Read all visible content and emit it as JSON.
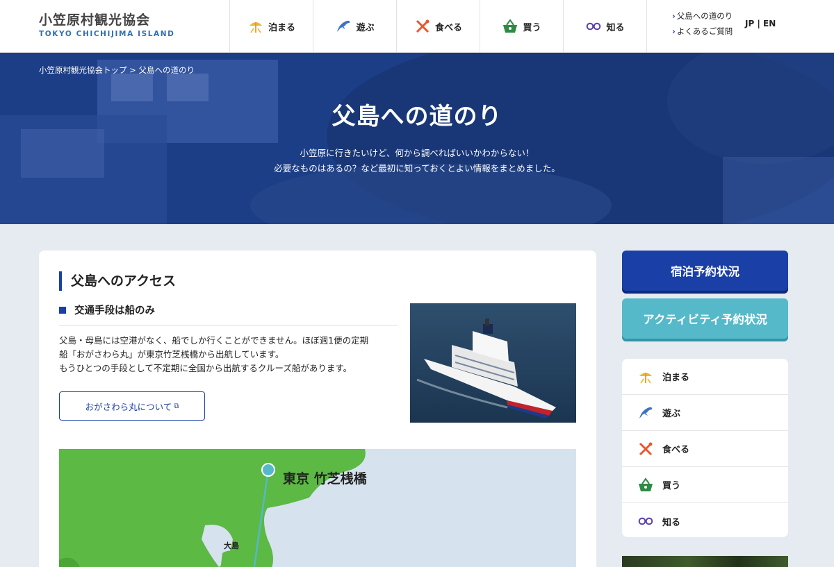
{
  "header": {
    "logo_jp": "小笠原村観光協会",
    "logo_en": "TOKYO CHICHIJIMA ISLAND",
    "nav": [
      {
        "label": "泊まる",
        "icon": "parasol-icon"
      },
      {
        "label": "遊ぶ",
        "icon": "dolphin-icon"
      },
      {
        "label": "食べる",
        "icon": "fork-knife-icon"
      },
      {
        "label": "買う",
        "icon": "basket-icon"
      },
      {
        "label": "知る",
        "icon": "glasses-icon"
      }
    ],
    "links": [
      "父島への道のり",
      "よくあるご質問"
    ],
    "lang": "JP | EN"
  },
  "hero": {
    "breadcrumb": "小笠原村観光協会トップ > 父島への道のり",
    "title": "父島への道のり",
    "subtitle_line1": "小笠原に行きたいけど、何から調べればいいかわからない！",
    "subtitle_line2": "必要なものはあるの？など最初に知っておくとよい情報をまとめました。"
  },
  "main": {
    "section_title": "父島へのアクセス",
    "sub_title": "交通手段は船のみ",
    "body_line1": "父島・母島には空港がなく、船でしか行くことができません。ほぼ週1便の定期",
    "body_line2": "船「おがさわら丸」が東京竹芝桟橋から出航しています。",
    "body_line3": "もうひとつの手段として不定期に全国から出航するクルーズ船があります。",
    "button_label": "おがさわら丸について",
    "map": {
      "label_tokyo": "東京 竹芝桟橋",
      "label_oshima": "大島"
    }
  },
  "sidebar": {
    "lodging_button": "宿泊予約状況",
    "activity_button": "アクティビティ予約状況",
    "menu": [
      {
        "label": "泊まる",
        "icon": "parasol-icon"
      },
      {
        "label": "遊ぶ",
        "icon": "dolphin-icon"
      },
      {
        "label": "食べる",
        "icon": "fork-knife-icon"
      },
      {
        "label": "買う",
        "icon": "basket-icon"
      },
      {
        "label": "知る",
        "icon": "glasses-icon"
      }
    ]
  },
  "colors": {
    "brand_blue": "#1a3fa6",
    "activity_teal": "#55b9c9",
    "map_land": "#5cb944",
    "map_sea": "#d7e2ef"
  }
}
